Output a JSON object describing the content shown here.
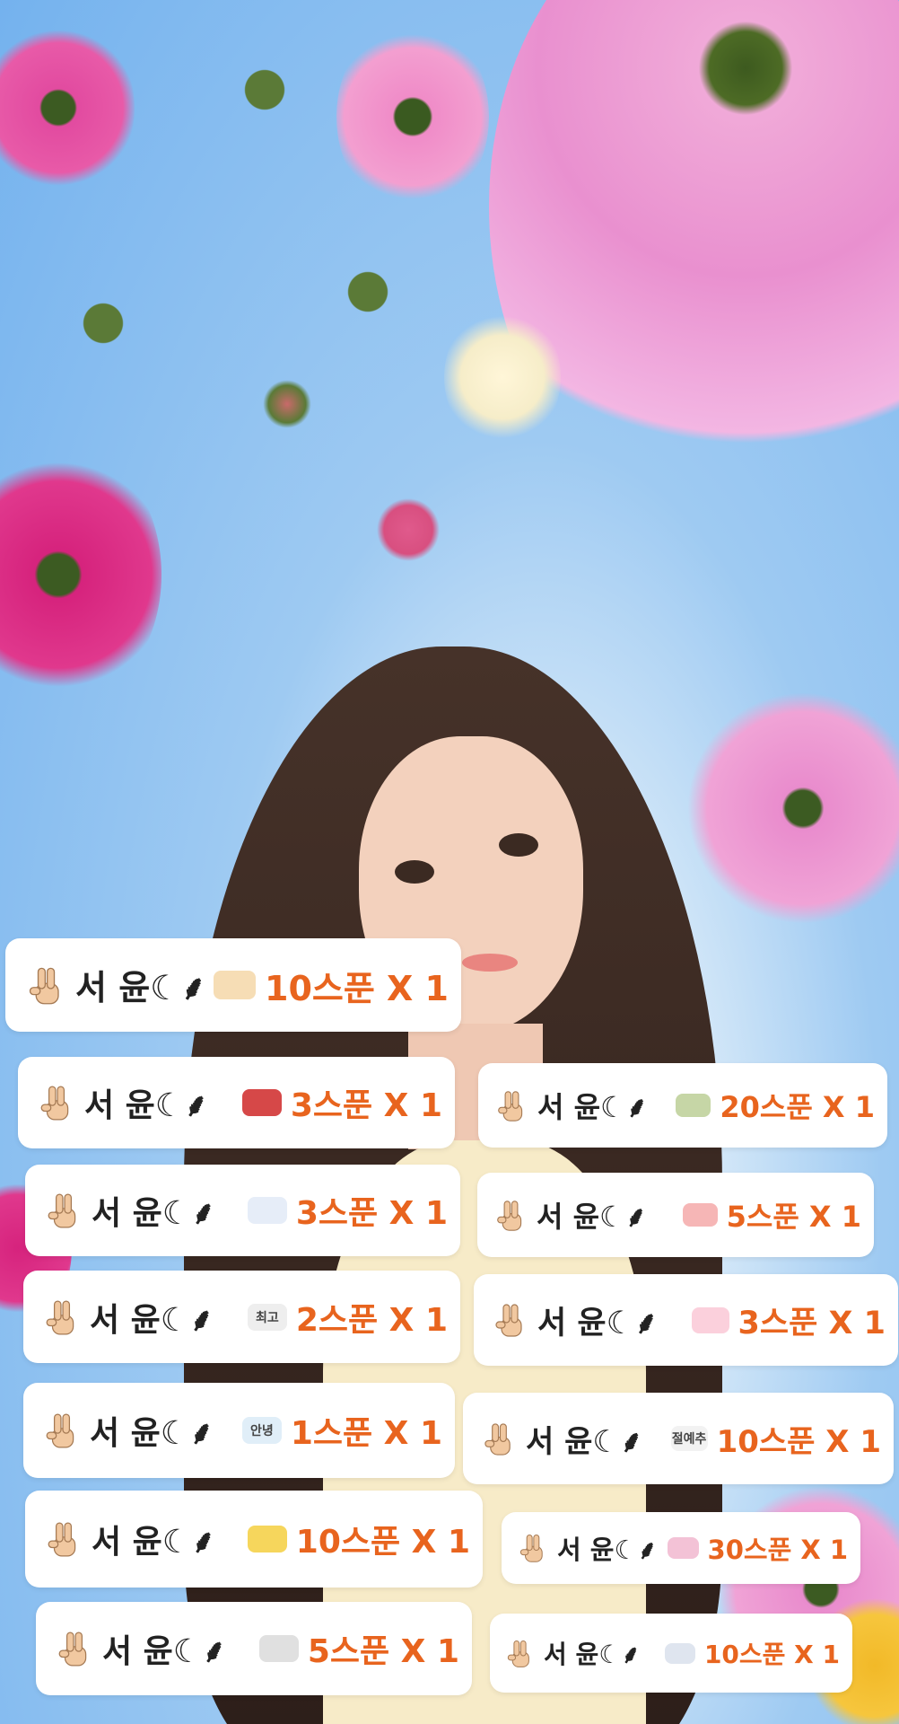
{
  "sender": {
    "name": "서 윤☾⸙"
  },
  "colors": {
    "sky": "#8ec1f1",
    "card": "#ffffff",
    "amount": "#e8641e"
  },
  "cards": [
    {
      "icon": "peace-hand-icon",
      "sticker": "decor-sticker",
      "sticker_text": "",
      "gift": "10스푼 X 1"
    },
    {
      "icon": "peace-hand-icon",
      "sticker": "red-bubble-sticker",
      "sticker_text": "",
      "gift": "3스푼 X 1"
    },
    {
      "icon": "peace-hand-icon",
      "sticker": "bunny-sticker",
      "sticker_text": "",
      "gift": "20스푼 X 1"
    },
    {
      "icon": "peace-hand-icon",
      "sticker": "sparkle-sticker",
      "sticker_text": "",
      "gift": "3스푼 X 1"
    },
    {
      "icon": "peace-hand-icon",
      "sticker": "peach-sticker",
      "sticker_text": "",
      "gift": "5스푼 X 1"
    },
    {
      "icon": "peace-hand-icon",
      "sticker": "speech-bubble-sticker",
      "sticker_text": "최고",
      "gift": "2스푼 X 1"
    },
    {
      "icon": "peace-hand-icon",
      "sticker": "flower-sticker",
      "sticker_text": "",
      "gift": "3스푼 X 1"
    },
    {
      "icon": "peace-hand-icon",
      "sticker": "hello-sticker",
      "sticker_text": "안녕",
      "gift": "1스푼 X 1"
    },
    {
      "icon": "peace-hand-icon",
      "sticker": "badge-sticker",
      "sticker_text": "절예추",
      "gift": "10스푼 X 1"
    },
    {
      "icon": "peace-hand-icon",
      "sticker": "emoji-sticker",
      "sticker_text": "",
      "gift": "10스푼 X 1"
    },
    {
      "icon": "peace-hand-icon",
      "sticker": "mini-sticker",
      "sticker_text": "",
      "gift": "30스푼 X 1"
    },
    {
      "icon": "peace-hand-icon",
      "sticker": "sign-sticker",
      "sticker_text": "",
      "gift": "5스푼 X 1"
    },
    {
      "icon": "peace-hand-icon",
      "sticker": "round-badge-sticker",
      "sticker_text": "",
      "gift": "10스푼 X 1"
    }
  ]
}
